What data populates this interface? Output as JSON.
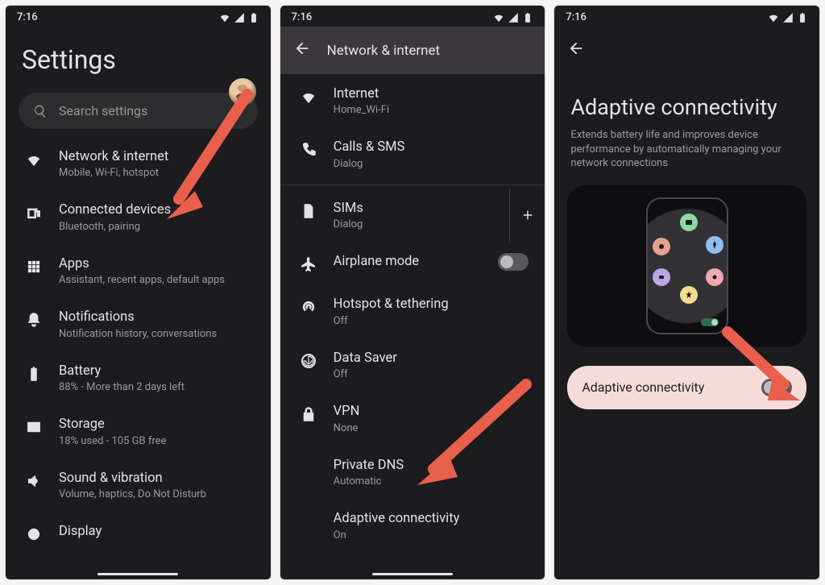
{
  "status": {
    "time": "7:16"
  },
  "screen1": {
    "title": "Settings",
    "search_placeholder": "Search settings",
    "items": [
      {
        "title": "Network & internet",
        "sub": "Mobile, Wi-Fi, hotspot",
        "icon": "wifi"
      },
      {
        "title": "Connected devices",
        "sub": "Bluetooth, pairing",
        "icon": "devices"
      },
      {
        "title": "Apps",
        "sub": "Assistant, recent apps, default apps",
        "icon": "apps"
      },
      {
        "title": "Notifications",
        "sub": "Notification history, conversations",
        "icon": "bell"
      },
      {
        "title": "Battery",
        "sub": "88% - More than 2 days left",
        "icon": "battery"
      },
      {
        "title": "Storage",
        "sub": "18% used - 105 GB free",
        "icon": "storage"
      },
      {
        "title": "Sound & vibration",
        "sub": "Volume, haptics, Do Not Disturb",
        "icon": "sound"
      },
      {
        "title": "Display",
        "sub": "",
        "icon": "display"
      }
    ]
  },
  "screen2": {
    "header": "Network & internet",
    "items": [
      {
        "title": "Internet",
        "sub": "Home_Wi-Fi",
        "icon": "wifi"
      },
      {
        "title": "Calls & SMS",
        "sub": "Dialog",
        "icon": "calls"
      },
      {
        "title": "SIMs",
        "sub": "Dialog",
        "icon": "sim",
        "plus": true
      },
      {
        "title": "Airplane mode",
        "sub": "",
        "icon": "airplane",
        "toggle": "off"
      },
      {
        "title": "Hotspot & tethering",
        "sub": "Off",
        "icon": "hotspot"
      },
      {
        "title": "Data Saver",
        "sub": "Off",
        "icon": "datasaver"
      },
      {
        "title": "VPN",
        "sub": "None",
        "icon": "vpn"
      },
      {
        "title": "Private DNS",
        "sub": "Automatic",
        "icon": ""
      },
      {
        "title": "Adaptive connectivity",
        "sub": "On",
        "icon": ""
      }
    ]
  },
  "screen3": {
    "title": "Adaptive connectivity",
    "desc": "Extends battery life and improves device performance by automatically managing your network connections",
    "toggle_label": "Adaptive connectivity",
    "toggle_state": "off"
  }
}
